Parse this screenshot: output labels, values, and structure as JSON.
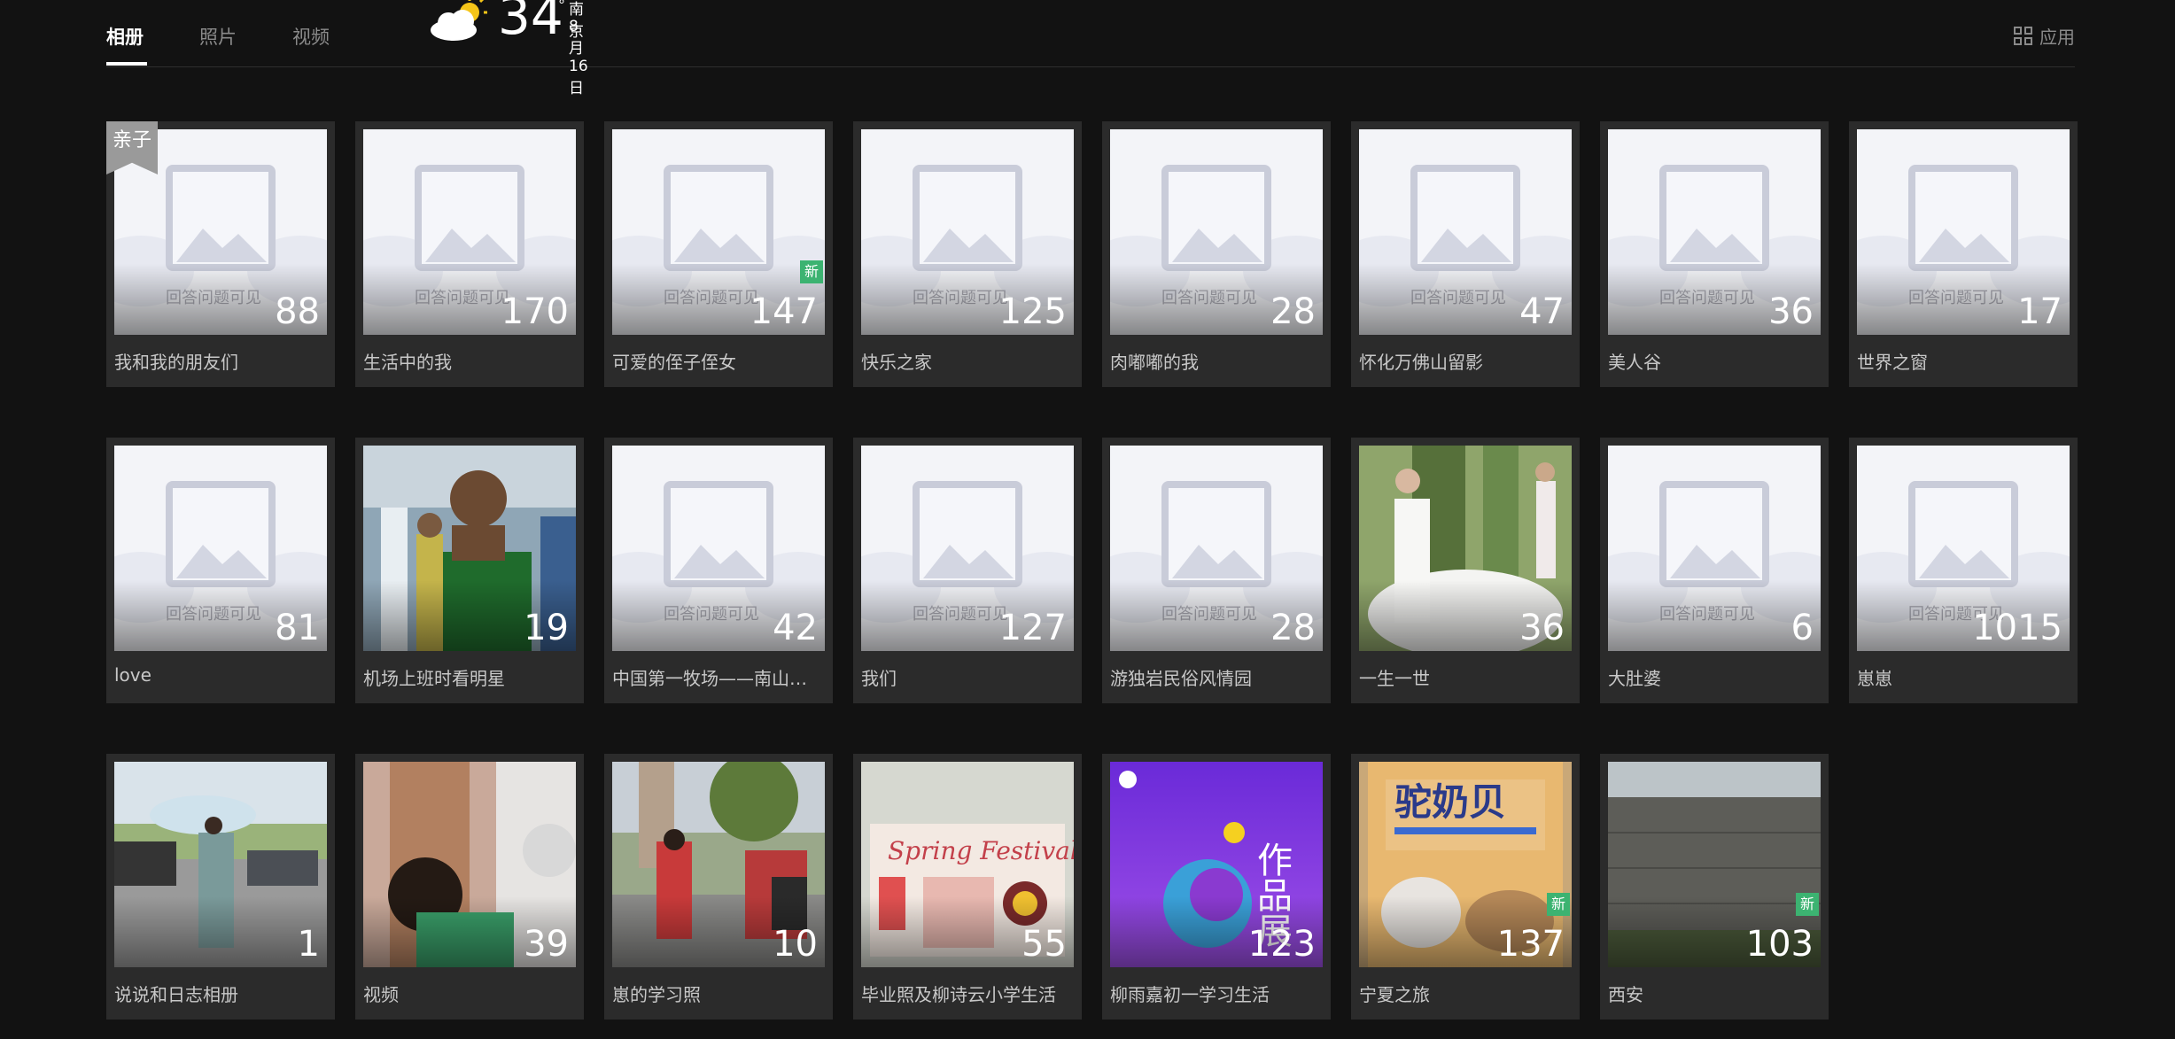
{
  "tabs": [
    {
      "label": "相册",
      "active": true
    },
    {
      "label": "照片",
      "active": false
    },
    {
      "label": "视频",
      "active": false
    }
  ],
  "weather": {
    "temp": "34",
    "deg": "°",
    "city": "南京",
    "date": "8月16日",
    "icon": "partly-sunny-icon"
  },
  "apps_label": "应用",
  "watermark": "回答问题可见",
  "new_label": "新",
  "albums": [
    {
      "name": "我和我的朋友们",
      "count": "88",
      "ribbon": "亲子",
      "thumb": "placeholder"
    },
    {
      "name": "生活中的我",
      "count": "170",
      "thumb": "placeholder"
    },
    {
      "name": "可爱的侄子侄女",
      "count": "147",
      "new": true,
      "thumb": "placeholder"
    },
    {
      "name": "快乐之家",
      "count": "125",
      "thumb": "placeholder"
    },
    {
      "name": "肉嘟嘟的我",
      "count": "28",
      "thumb": "placeholder"
    },
    {
      "name": "怀化万佛山留影",
      "count": "47",
      "thumb": "placeholder"
    },
    {
      "name": "美人谷",
      "count": "36",
      "thumb": "placeholder"
    },
    {
      "name": "世界之窗",
      "count": "17",
      "thumb": "placeholder"
    },
    {
      "name": "love",
      "count": "81",
      "thumb": "placeholder"
    },
    {
      "name": "机场上班时看明星",
      "count": "19",
      "thumb": "photo-airport"
    },
    {
      "name": "中国第一牧场——南山…",
      "count": "42",
      "thumb": "placeholder"
    },
    {
      "name": "我们",
      "count": "127",
      "thumb": "placeholder"
    },
    {
      "name": "游独岩民俗风情园",
      "count": "28",
      "thumb": "placeholder"
    },
    {
      "name": "一生一世",
      "count": "36",
      "thumb": "photo-wedding"
    },
    {
      "name": "大肚婆",
      "count": "6",
      "thumb": "placeholder"
    },
    {
      "name": "崽崽",
      "count": "1015",
      "thumb": "placeholder"
    },
    {
      "name": "说说和日志相册",
      "count": "1",
      "thumb": "photo-umbrella"
    },
    {
      "name": "视频",
      "count": "39",
      "thumb": "photo-child"
    },
    {
      "name": "崽的学习照",
      "count": "10",
      "thumb": "photo-street"
    },
    {
      "name": "毕业照及柳诗云小学生活",
      "count": "55",
      "thumb": "photo-poster"
    },
    {
      "name": "柳雨嘉初一学习生活",
      "count": "123",
      "thumb": "photo-purple"
    },
    {
      "name": "宁夏之旅",
      "count": "137",
      "new": true,
      "thumb": "photo-package"
    },
    {
      "name": "西安",
      "count": "103",
      "new": true,
      "thumb": "photo-wall"
    }
  ],
  "photo_texts": {
    "package": "驼奶贝",
    "poster_side": "作品展"
  }
}
